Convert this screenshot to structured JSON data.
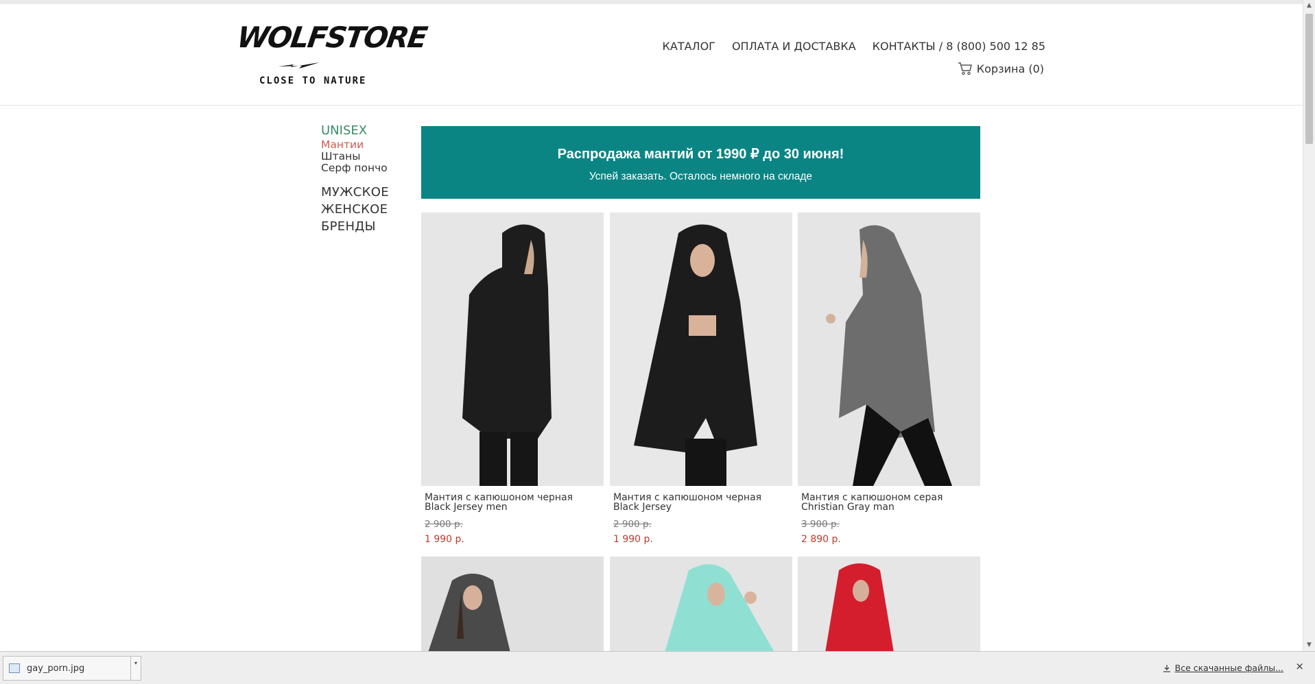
{
  "header": {
    "logo": {
      "word": "WOLFSTORE",
      "tagline": "CLOSE TO NATURE"
    },
    "nav": [
      "КАТАЛОГ",
      "ОПЛАТА И ДОСТАВКА",
      "КОНТАКТЫ / 8 (800) 500 12 85"
    ],
    "cart_label": "Корзина (0)"
  },
  "sidebar": {
    "section": "UNISEX",
    "sub_items": [
      {
        "label": "Мантии",
        "active": true
      },
      {
        "label": "Штаны",
        "active": false
      },
      {
        "label": "Серф пончо",
        "active": false
      }
    ],
    "main_items": [
      "МУЖСКОЕ",
      "ЖЕНСКОЕ",
      "БРЕНДЫ"
    ]
  },
  "banner": {
    "title": "Распродажа мантий от 1990 ₽ до 30 июня!",
    "subtitle": "Успей заказать. Осталось немного на складе"
  },
  "products": [
    {
      "name": "Мантия с капюшоном черная Black Jersey men",
      "old_price": "2 900 р.",
      "price": "1 990 р.",
      "color": "black"
    },
    {
      "name": "Мантия с капюшоном черная Black Jersey",
      "old_price": "2 900 р.",
      "price": "1 990 р.",
      "color": "black"
    },
    {
      "name": "Мантия с капюшоном серая Christian Gray man",
      "old_price": "3 900 р.",
      "price": "2 890 р.",
      "color": "gray"
    }
  ],
  "products_partial": [
    {
      "color": "dark-gray"
    },
    {
      "color": "mint"
    },
    {
      "color": "red"
    }
  ],
  "download_bar": {
    "file_name": "gay_porn.jpg",
    "all_downloads": "Все скачанные файлы...",
    "close": "×"
  },
  "colors": {
    "banner_bg": "#0a8584",
    "sidebar_section": "#3a8a6a",
    "active_item": "#d05a52",
    "price": "#c0392b"
  }
}
